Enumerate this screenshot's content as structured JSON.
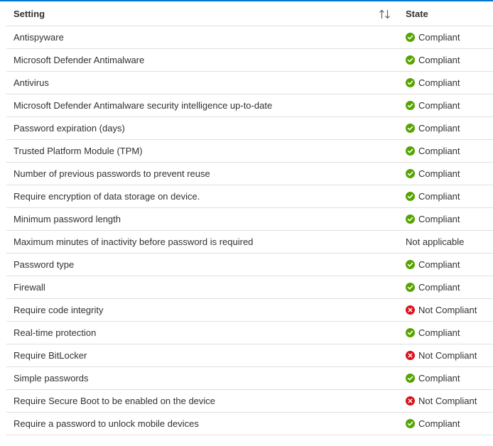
{
  "columns": {
    "setting": "Setting",
    "state": "State"
  },
  "status_colors": {
    "compliant": "#57a300",
    "not_compliant": "#d9121b"
  },
  "rows": [
    {
      "setting": "Antispyware",
      "state": "Compliant",
      "status": "compliant",
      "icon": "check-circle-icon"
    },
    {
      "setting": "Microsoft Defender Antimalware",
      "state": "Compliant",
      "status": "compliant",
      "icon": "check-circle-icon"
    },
    {
      "setting": "Antivirus",
      "state": "Compliant",
      "status": "compliant",
      "icon": "check-circle-icon"
    },
    {
      "setting": "Microsoft Defender Antimalware security intelligence up-to-date",
      "state": "Compliant",
      "status": "compliant",
      "icon": "check-circle-icon"
    },
    {
      "setting": "Password expiration (days)",
      "state": "Compliant",
      "status": "compliant",
      "icon": "check-circle-icon"
    },
    {
      "setting": "Trusted Platform Module (TPM)",
      "state": "Compliant",
      "status": "compliant",
      "icon": "check-circle-icon"
    },
    {
      "setting": "Number of previous passwords to prevent reuse",
      "state": "Compliant",
      "status": "compliant",
      "icon": "check-circle-icon"
    },
    {
      "setting": "Require encryption of data storage on device.",
      "state": "Compliant",
      "status": "compliant",
      "icon": "check-circle-icon"
    },
    {
      "setting": "Minimum password length",
      "state": "Compliant",
      "status": "compliant",
      "icon": "check-circle-icon"
    },
    {
      "setting": "Maximum minutes of inactivity before password is required",
      "state": "Not applicable",
      "status": "not-applicable",
      "icon": ""
    },
    {
      "setting": "Password type",
      "state": "Compliant",
      "status": "compliant",
      "icon": "check-circle-icon"
    },
    {
      "setting": "Firewall",
      "state": "Compliant",
      "status": "compliant",
      "icon": "check-circle-icon"
    },
    {
      "setting": "Require code integrity",
      "state": "Not Compliant",
      "status": "not-compliant",
      "icon": "error-circle-icon"
    },
    {
      "setting": "Real-time protection",
      "state": "Compliant",
      "status": "compliant",
      "icon": "check-circle-icon"
    },
    {
      "setting": "Require BitLocker",
      "state": "Not Compliant",
      "status": "not-compliant",
      "icon": "error-circle-icon"
    },
    {
      "setting": "Simple passwords",
      "state": "Compliant",
      "status": "compliant",
      "icon": "check-circle-icon"
    },
    {
      "setting": "Require Secure Boot to be enabled on the device",
      "state": "Not Compliant",
      "status": "not-compliant",
      "icon": "error-circle-icon"
    },
    {
      "setting": "Require a password to unlock mobile devices",
      "state": "Compliant",
      "status": "compliant",
      "icon": "check-circle-icon"
    }
  ]
}
